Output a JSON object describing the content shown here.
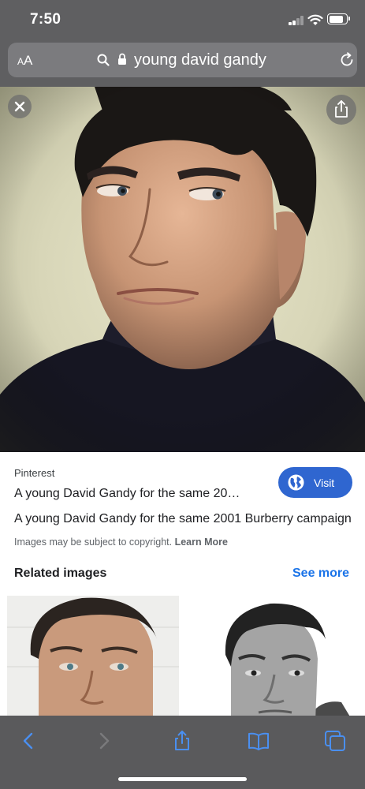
{
  "status_bar": {
    "time": "7:50",
    "signal_bars_filled": 2,
    "signal_bars_total": 4,
    "battery_level": 0.82,
    "icons": [
      "signal-icon",
      "wifi-icon",
      "battery-icon"
    ]
  },
  "url_bar": {
    "text_size_label_small": "A",
    "text_size_label_large": "A",
    "url_text": "young david gandy",
    "icons": [
      "search-icon",
      "lock-icon",
      "reload-icon"
    ]
  },
  "hero": {
    "icons": [
      "close-icon",
      "share-icon"
    ]
  },
  "result": {
    "source": "Pinterest",
    "title": "A young David Gandy for the same 20…",
    "visit_label": "Visit",
    "description": "A young David Gandy for the same 2001 Burberry campaign",
    "copyright_text": "Images may be subject to copyright.",
    "learn_more": "Learn More"
  },
  "related": {
    "heading": "Related images",
    "see_more": "See more"
  },
  "toolbar": {
    "icons": [
      "back-icon",
      "forward-icon",
      "share-icon",
      "bookmarks-icon",
      "tabs-icon"
    ]
  },
  "colors": {
    "accent": "#2f66d0",
    "link": "#1a73e8",
    "chrome": "#5f5f61"
  }
}
